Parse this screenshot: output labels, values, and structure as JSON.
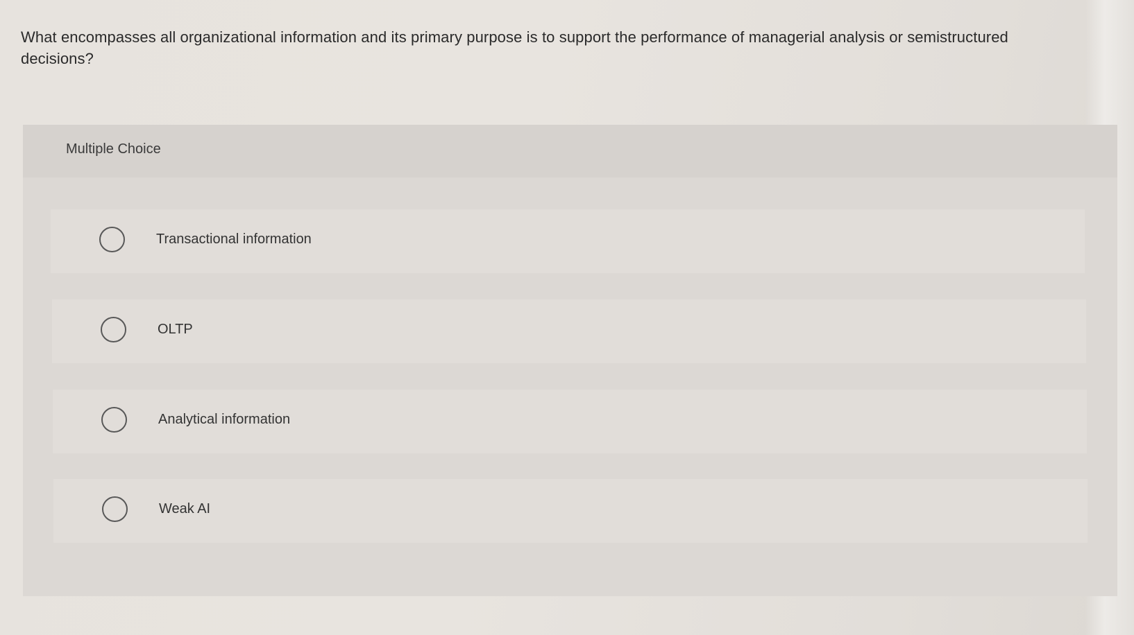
{
  "question": {
    "text": "What encompasses all organizational information and its primary purpose is to support the performance of managerial analysis or semistructured decisions?"
  },
  "multiple_choice": {
    "title": "Multiple Choice",
    "options": [
      {
        "label": "Transactional information",
        "selected": false
      },
      {
        "label": "OLTP",
        "selected": false
      },
      {
        "label": "Analytical information",
        "selected": false
      },
      {
        "label": "Weak AI",
        "selected": false
      }
    ]
  }
}
